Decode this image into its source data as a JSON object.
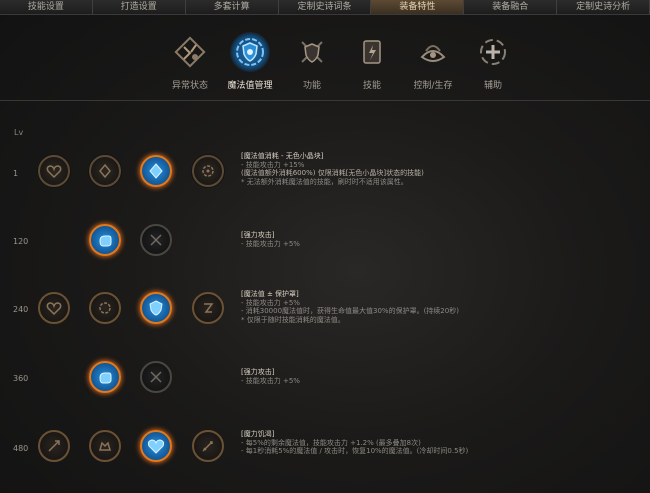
{
  "tabs": [
    "技能设置",
    "打造设置",
    "多套计算",
    "定制史诗词条",
    "装备特性",
    "装备融合",
    "定制史诗分析"
  ],
  "active_tab": 4,
  "categories": [
    {
      "label": "异常状态",
      "icon": "status-ailment-icon"
    },
    {
      "label": "魔法值管理",
      "icon": "mana-shield-icon"
    },
    {
      "label": "功能",
      "icon": "shield-sword-icon"
    },
    {
      "label": "技能",
      "icon": "skill-book-icon"
    },
    {
      "label": "控制/生存",
      "icon": "control-survival-icon"
    },
    {
      "label": "辅助",
      "icon": "support-icon"
    }
  ],
  "active_category": 1,
  "lv_header": "Lv",
  "rows": [
    {
      "lv": "1",
      "desc": {
        "title": "[魔法值消耗 - 无色小晶块]",
        "lines": [
          "- 技能攻击力 +15%",
          "(魔法值额外消耗600%) 仅限消耗[无色小晶块]状态的技能)",
          "* 无法额外消耗魔法值的技能，刷时时不适用该属性。"
        ]
      }
    },
    {
      "lv": "120",
      "desc": {
        "title": "[强力攻击]",
        "lines": [
          "- 技能攻击力 +5%"
        ]
      }
    },
    {
      "lv": "240",
      "desc": {
        "title": "[魔法值 ± 保护罩]",
        "lines": [
          "- 技能攻击力 +5%",
          "- 消耗30000魔法值时，获得生命值最大值30%的保护罩。(持续20秒)",
          "* 仅限于随时技能消耗的魔法值。"
        ]
      }
    },
    {
      "lv": "360",
      "desc": {
        "title": "[强力攻击]",
        "lines": [
          "- 技能攻击力 +5%"
        ]
      }
    },
    {
      "lv": "480",
      "desc": {
        "title": "[魔力饥渴]",
        "lines": [
          "- 每5%的剩余魔法值，技能攻击力 +1.2% (最多叠加8次)",
          "- 每1秒消耗5%的魔法值 / 攻击时，恢复10%的魔法值。(冷却时间0.5秒)"
        ]
      }
    }
  ]
}
